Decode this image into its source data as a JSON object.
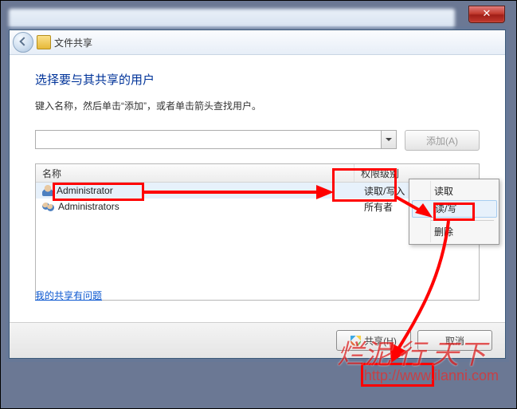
{
  "nav": {
    "title": "文件共享"
  },
  "close_glyph": "✕",
  "heading": "选择要与其共享的用户",
  "subtext": "键入名称，然后单击“添加”，或者单击箭头查找用户。",
  "add_button": "添加(A)",
  "columns": {
    "name": "名称",
    "perm": "权限级别"
  },
  "rows": [
    {
      "name": "Administrator",
      "perm": "读取/写入",
      "dropdown": true,
      "selected": true,
      "icon": "user"
    },
    {
      "name": "Administrators",
      "perm": "所有者",
      "dropdown": false,
      "selected": false,
      "icon": "group"
    }
  ],
  "popup": {
    "items": [
      {
        "label": "读取",
        "checked": false,
        "highlight": false
      },
      {
        "label": "读/写",
        "checked": true,
        "highlight": true
      }
    ],
    "delete": "删除"
  },
  "help_link": "我的共享有问题",
  "footer": {
    "share": "共享(H)",
    "cancel": "取消"
  },
  "watermark": {
    "text": "烂泥 行 天下",
    "url": "http://www.ilanni.com"
  }
}
